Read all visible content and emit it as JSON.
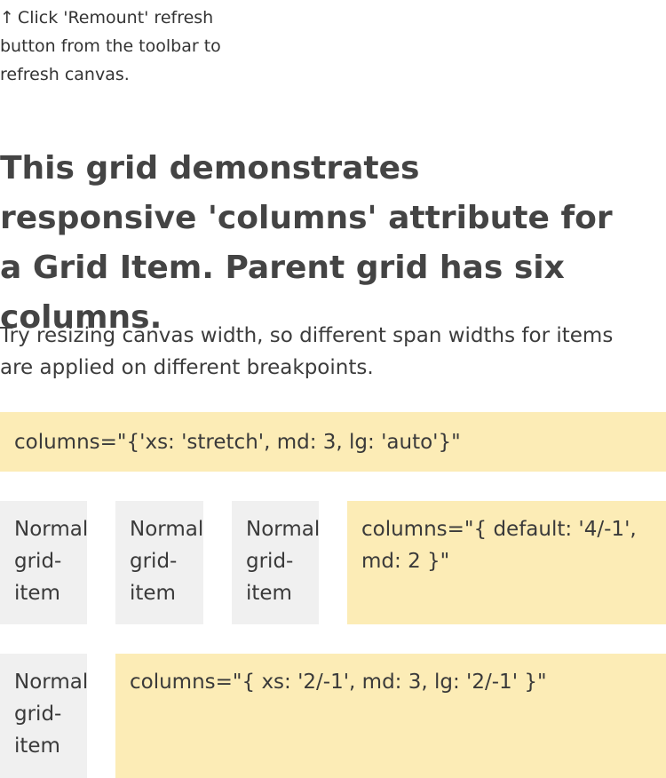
{
  "hint": {
    "arrow": "↑",
    "text": "Click 'Remount' refresh button from the toolbar to refresh canvas."
  },
  "heading": "This grid demonstrates responsive 'columns' attribute for a Grid Item. Parent grid has six columns.",
  "description": "Try resizing canvas width, so different span widths for items are applied on different breakpoints.",
  "grid": {
    "row1": {
      "item": "columns=\"{'xs: 'stretch', md: 3, lg: 'auto'}\""
    },
    "row2": {
      "normal_1": "Normal grid-item",
      "normal_2": "Normal grid-item",
      "normal_3": "Normal grid-item",
      "item": "columns=\"{ default: '4/-1', md: 2 }\""
    },
    "row3": {
      "normal_1": "Normal grid-item",
      "item": "columns=\"{ xs: '2/-1', md: 3, lg: '2/-1' }\""
    }
  },
  "colors": {
    "highlight": "#fcecb6",
    "normal": "#f0f0f0",
    "text": "#333333"
  }
}
